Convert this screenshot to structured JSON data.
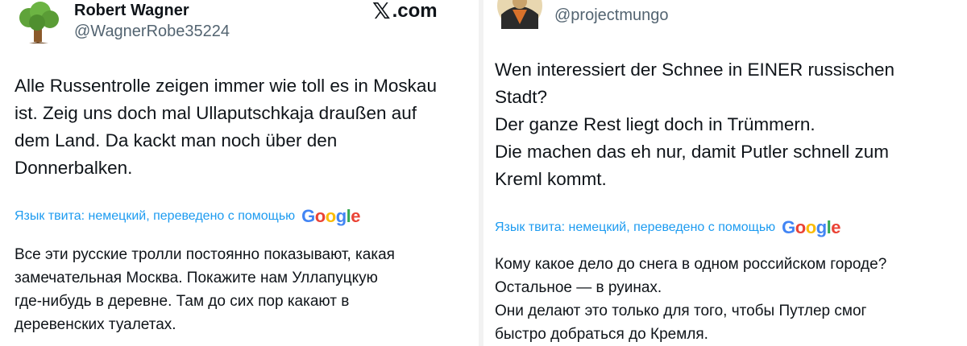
{
  "left_post": {
    "author_name": "Robert Wagner",
    "author_handle": "@WagnerRobe35224",
    "source_label": ".com",
    "tweet_text": "Alle Russentrolle zeigen immer wie toll es in Moskau\nist. Zeig uns doch mal Ullaputschkaja draußen auf\ndem Land. Da kackt man noch über den\nDonnerbalken.",
    "translate_label": "Язык твита: немецкий, переведено с помощью",
    "translation_text": "Все эти русские тролли постоянно показывают, какая\nзамечательная Москва. Покажите нам Уллапуцкую\nгде-нибудь в деревне. Там до сих пор какают в\nдеревенских туалетах."
  },
  "right_post": {
    "author_handle": "@projectmungo",
    "tweet_text": "Wen interessiert der Schnee in EINER russischen\nStadt?\nDer ganze Rest liegt doch in Trümmern.\nDie machen das eh nur, damit Putler schnell zum\nKreml kommt.",
    "translate_label": "Язык твита: немецкий, переведено с помощью",
    "translation_text": "Кому какое дело до снега в одном российском городе?\nОстальное — в руинах.\nОни делают это только для того, чтобы Путлер смог\nбыстро добраться до Кремля."
  },
  "google_logo": {
    "letters": [
      "G",
      "o",
      "o",
      "g",
      "l",
      "e"
    ],
    "colors": [
      "#4285F4",
      "#EA4335",
      "#FBBC05",
      "#4285F4",
      "#34A853",
      "#EA4335"
    ]
  },
  "icons": {
    "left_avatar": "tree-avatar-icon",
    "right_avatar": "cartoon-avatar-icon",
    "source": "x-logo-icon"
  },
  "colors": {
    "link": "#1d9bf0",
    "handle": "#536471",
    "text": "#0f1419"
  }
}
